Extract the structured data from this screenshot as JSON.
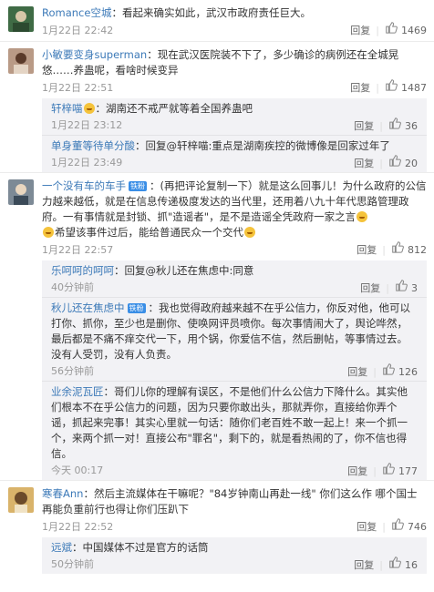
{
  "comments": [
    {
      "user": "Romance空城",
      "user_color": "blue",
      "text": "：看起来确实如此，武汉市政府责任巨大。",
      "time": "1月22日 22:42",
      "reply_label": "回复",
      "likes": "1469",
      "avatar_color": "#4a7a4a",
      "replies": []
    },
    {
      "user": "小敏要变身superman",
      "user_color": "blue",
      "text": "：现在武汉医院装不下了，多少确诊的病例还在全城晃悠……养蛊呢，看啥时候变异",
      "time": "1月22日 22:51",
      "reply_label": "回复",
      "likes": "1487",
      "avatar_color": "#8a6a5a",
      "replies": [
        {
          "user": "轩梓喵",
          "text": "：湖南还不戒严就等着全国养蛊吧",
          "time": "1月22日 23:12",
          "reply_label": "回复",
          "likes": "36"
        },
        {
          "user": "单身董等待单分酸",
          "text": "：回复@轩梓喵:重点是湖南疾控的微博像是回家过年了",
          "time": "1月22日 23:49",
          "reply_label": "回复",
          "likes": "20"
        }
      ]
    },
    {
      "user": "一个没有车的车手",
      "user_color": "blue",
      "badge": "铁粉",
      "text": "：(再把评论复制一下）就是这么回事儿！为什么政府的公信力越来越低，就是在信息传递极度发达的当代里，还用着八九十年代思路管理政府。一有事情就是封锁、抓\"造谣者\"，是不是造谣全凭政府一家之言",
      "text2": "希望该事件过后，能给普通民众一个交代",
      "time": "1月22日 22:57",
      "reply_label": "回复",
      "likes": "812",
      "avatar_color": "#6a7a8a",
      "replies": [
        {
          "user": "乐呵呵的呵呵",
          "text": "：回复@秋儿还在焦虑中:同意",
          "time": "40分钟前",
          "reply_label": "回复",
          "likes": "3"
        },
        {
          "user": "秋儿还在焦虑中",
          "badge": "铁粉",
          "text": "：我也觉得政府越来越不在乎公信力，你反对他，他可以打你、抓你，至少也是删你、使唤网评员喷你。每次事情闹大了，舆论哗然，最后都是不痛不痒交代一下，用个锅，你爱信不信，然后删帖，等事情过去。没有人受罚，没有人负责。",
          "time": "56分钟前",
          "reply_label": "回复",
          "likes": "126"
        },
        {
          "user": "业余泥瓦匠",
          "text": "：哥们儿你的理解有误区，不是他们什么公信力下降什么。其实他们根本不在乎公信力的问题，因为只要你敢出头，那就弄你，直接给你弄个谣，抓起来完事！其实心里就一句话：随你们老百姓不敢一起上！来一个抓一个，来两个抓一对！直接公布\"罪名\"，剩下的，就是看热闹的了，你不信也得信。",
          "time": "今天 00:17",
          "reply_label": "回复",
          "likes": "177"
        }
      ]
    },
    {
      "user": "寒春Ann",
      "user_color": "blue",
      "text": "：然后主流媒体在干嘛呢？\"84岁钟南山再赴一线\" 你们这么作 哪个国士再能负重前行也得让你们压趴下",
      "time": "1月22日 22:52",
      "reply_label": "回复",
      "likes": "746",
      "avatar_color": "#c9a05a",
      "replies": [
        {
          "user": "远斌",
          "text": "：中国媒体不过是官方的话筒",
          "time": "50分钟前",
          "reply_label": "回复",
          "likes": "16"
        }
      ]
    }
  ]
}
